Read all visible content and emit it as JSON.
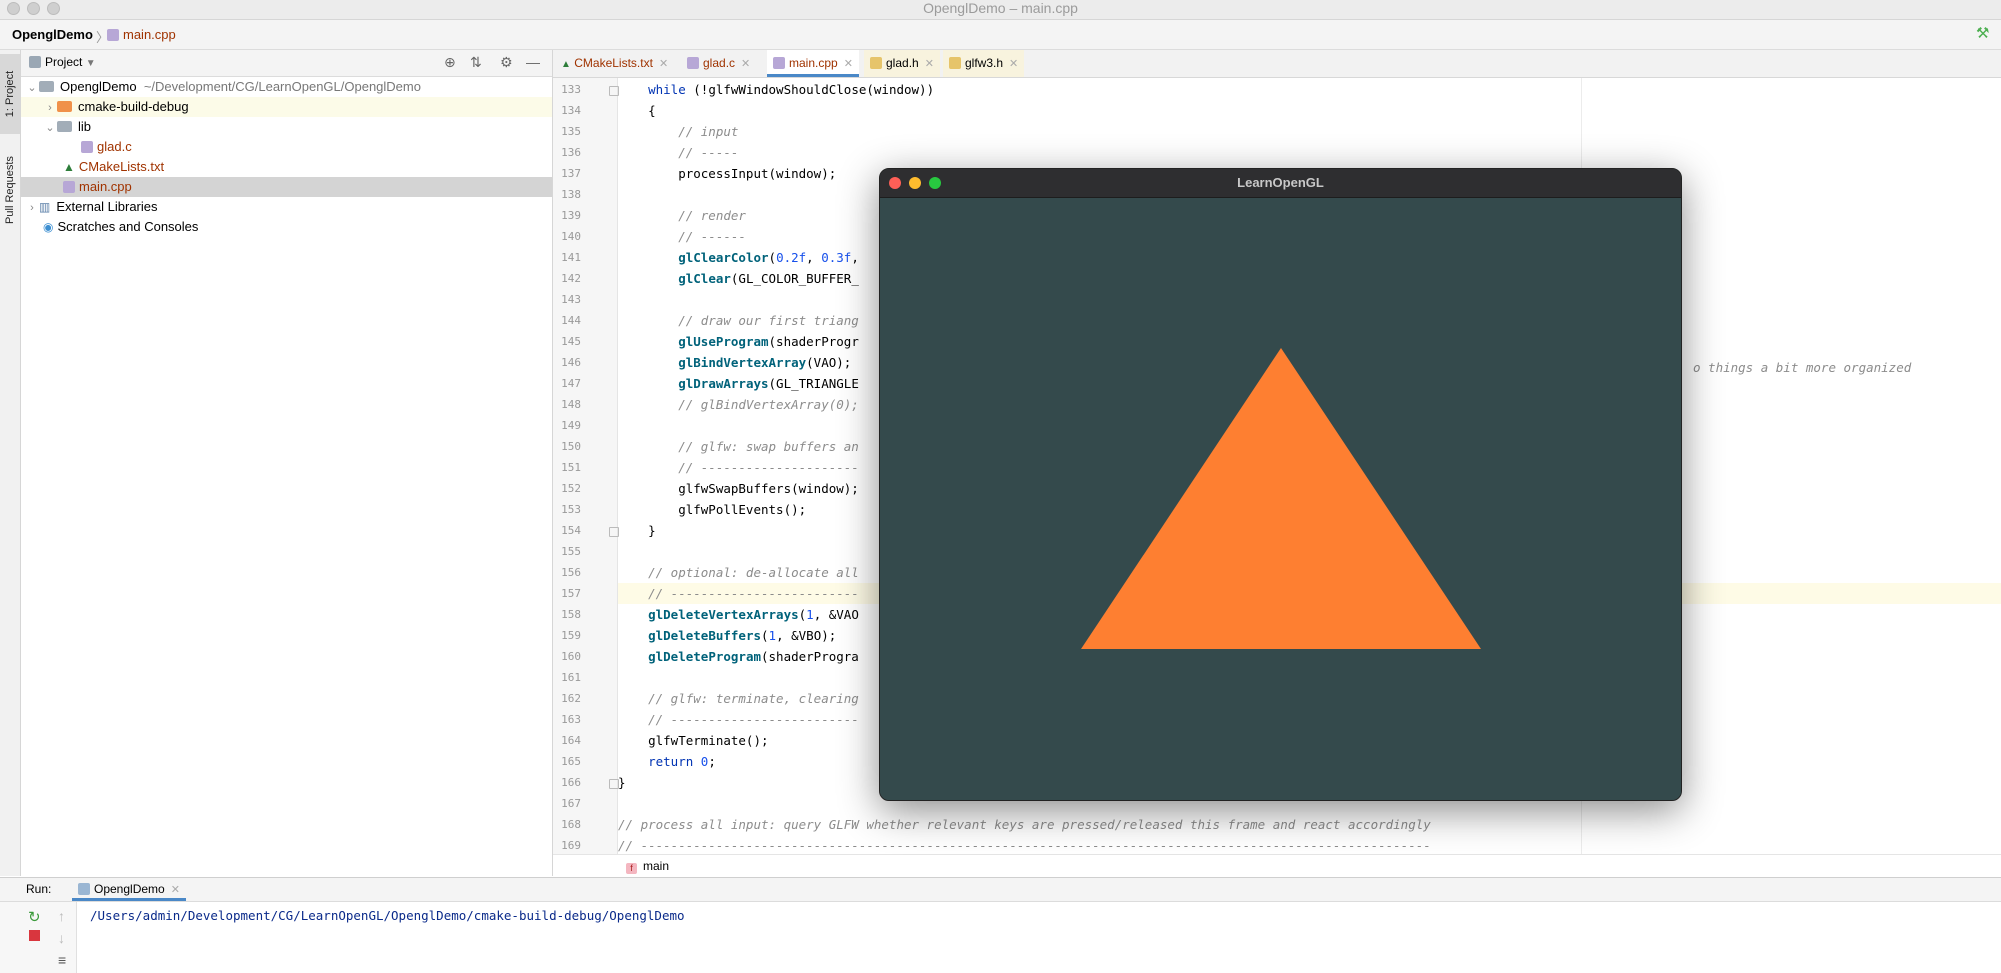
{
  "window": {
    "title": "OpenglDemo – main.cpp"
  },
  "navbar": {
    "project": "OpenglDemo",
    "file": "main.cpp"
  },
  "left_strip": {
    "project_tab": "1: Project",
    "pull_requests_tab": "Pull Requests"
  },
  "project_panel": {
    "title": "Project",
    "tree": [
      {
        "name": "OpenglDemo",
        "path": "~/Development/CG/LearnOpenGL/OpenglDemo"
      },
      {
        "name": "cmake-build-debug"
      },
      {
        "name": "lib"
      },
      {
        "name": "glad.c"
      },
      {
        "name": "CMakeLists.txt"
      },
      {
        "name": "main.cpp"
      },
      {
        "name": "External Libraries"
      },
      {
        "name": "Scratches and Consoles"
      }
    ]
  },
  "tabs": [
    {
      "label": "CMakeLists.txt"
    },
    {
      "label": "glad.c"
    },
    {
      "label": "main.cpp"
    },
    {
      "label": "glad.h"
    },
    {
      "label": "glfw3.h"
    }
  ],
  "code_lines": [
    {
      "n": "133",
      "t": "    while (!glfwWindowShouldClose(window))"
    },
    {
      "n": "134",
      "t": "    {"
    },
    {
      "n": "135",
      "t": "        // input"
    },
    {
      "n": "136",
      "t": "        // -----"
    },
    {
      "n": "137",
      "t": "        processInput(window);"
    },
    {
      "n": "138",
      "t": ""
    },
    {
      "n": "139",
      "t": "        // render"
    },
    {
      "n": "140",
      "t": "        // ------"
    },
    {
      "n": "141",
      "t": "        glClearColor(0.2f, 0.3f,"
    },
    {
      "n": "142",
      "t": "        glClear(GL_COLOR_BUFFER_"
    },
    {
      "n": "143",
      "t": ""
    },
    {
      "n": "144",
      "t": "        // draw our first triang"
    },
    {
      "n": "145",
      "t": "        glUseProgram(shaderProgr"
    },
    {
      "n": "146",
      "t": "        glBindVertexArray(VAO); "
    },
    {
      "n": "147",
      "t": "        glDrawArrays(GL_TRIANGLE"
    },
    {
      "n": "148",
      "t": "        // glBindVertexArray(0);"
    },
    {
      "n": "149",
      "t": ""
    },
    {
      "n": "150",
      "t": "        // glfw: swap buffers an"
    },
    {
      "n": "151",
      "t": "        // ---------------------"
    },
    {
      "n": "152",
      "t": "        glfwSwapBuffers(window);"
    },
    {
      "n": "153",
      "t": "        glfwPollEvents();"
    },
    {
      "n": "154",
      "t": "    }"
    },
    {
      "n": "155",
      "t": ""
    },
    {
      "n": "156",
      "t": "    // optional: de-allocate all"
    },
    {
      "n": "157",
      "t": "    // -------------------------"
    },
    {
      "n": "158",
      "t": "    glDeleteVertexArrays(1, &VAO"
    },
    {
      "n": "159",
      "t": "    glDeleteBuffers(1, &VBO);"
    },
    {
      "n": "160",
      "t": "    glDeleteProgram(shaderProgra"
    },
    {
      "n": "161",
      "t": ""
    },
    {
      "n": "162",
      "t": "    // glfw: terminate, clearing"
    },
    {
      "n": "163",
      "t": "    // -------------------------"
    },
    {
      "n": "164",
      "t": "    glfwTerminate();"
    },
    {
      "n": "165",
      "t": "    return 0;"
    },
    {
      "n": "166",
      "t": "}"
    },
    {
      "n": "167",
      "t": ""
    },
    {
      "n": "168",
      "t": "// process all input: query GLFW whether relevant keys are pressed/released this frame and react accordingly"
    },
    {
      "n": "169",
      "t": "// ---------------------------------------------------------------------------------------------------------"
    }
  ],
  "overflow_comment": "o things a bit more organized",
  "bottom_breadcrumb": {
    "function": "main"
  },
  "run_panel": {
    "label": "Run:",
    "config": "OpenglDemo",
    "output": "/Users/admin/Development/CG/LearnOpenGL/OpenglDemo/cmake-build-debug/OpenglDemo"
  },
  "gl_window": {
    "title": "LearnOpenGL",
    "clear_color": "#344a4c",
    "triangle_color": "#fe7f31"
  },
  "colors": {
    "accent": "#4a88c7",
    "folder": "#a2adb8",
    "folder_build": "#f0914a"
  }
}
